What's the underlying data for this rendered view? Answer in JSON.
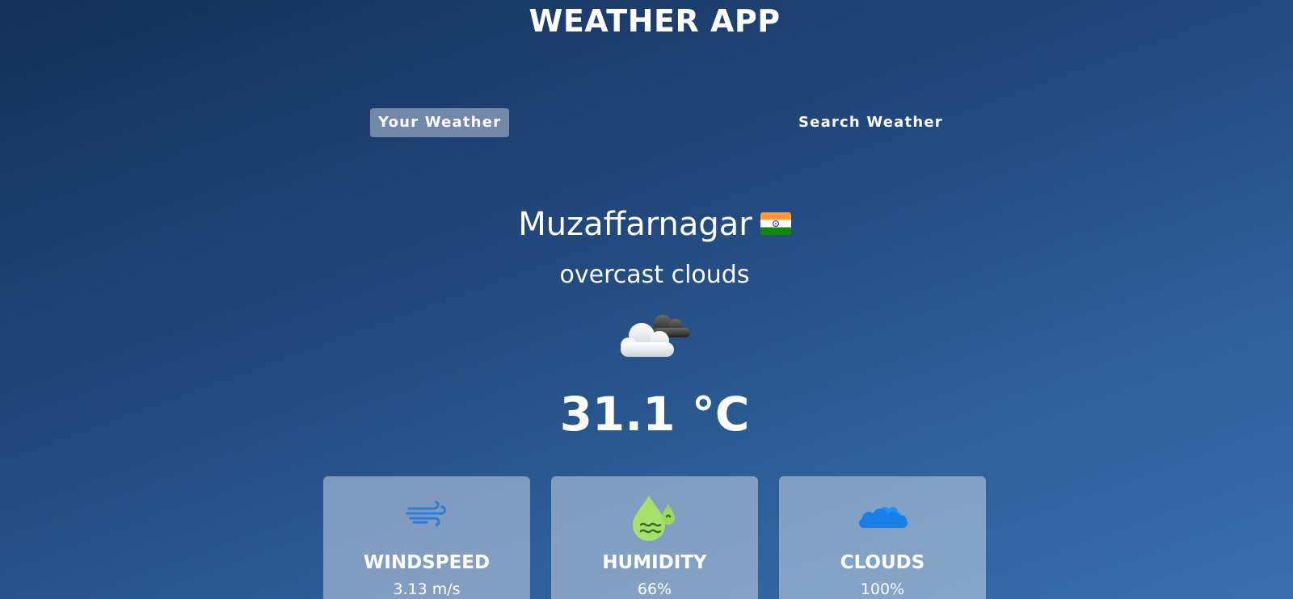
{
  "app": {
    "title": "WEATHER APP"
  },
  "tabs": [
    {
      "label": "Your Weather",
      "active": true
    },
    {
      "label": "Search Weather",
      "active": false
    }
  ],
  "weather": {
    "city": "Muzaffarnagar",
    "country_flag_icon": "india-flag-icon",
    "description": "overcast clouds",
    "condition_icon": "overcast-clouds-icon",
    "temperature": "31.1 °C"
  },
  "stats": {
    "windspeed": {
      "label": "WINDSPEED",
      "value": "3.13 m/s",
      "icon": "wind-icon"
    },
    "humidity": {
      "label": "HUMIDITY",
      "value": "66%",
      "icon": "humidity-icon"
    },
    "clouds": {
      "label": "CLOUDS",
      "value": "100%",
      "icon": "cloud-icon"
    }
  },
  "colors": {
    "background_top": "#15305a",
    "background_bottom": "#3a6fae",
    "active_tab": "#dbe2ef",
    "wind_icon": "#2f7fd6",
    "humidity_icon": "#a6e06b",
    "cloud_icon": "#1e90ff"
  }
}
